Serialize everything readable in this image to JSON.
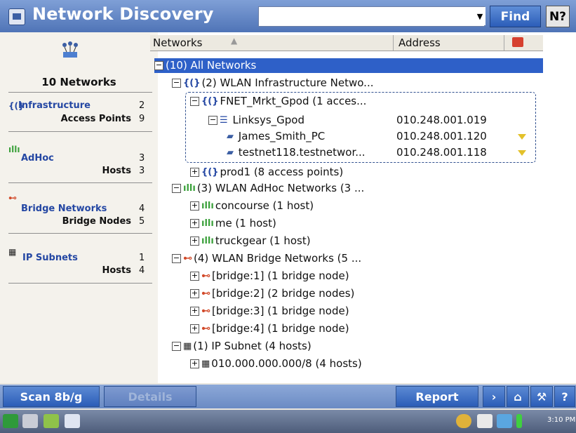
{
  "window": {
    "title": "Network Discovery"
  },
  "toolbar": {
    "search_value": "",
    "find_label": "Find",
    "help_label": "N?"
  },
  "sidebar": {
    "summary_title": "10 Networks",
    "groups": [
      {
        "category": "Infrastructure",
        "category_count": "2",
        "sub": "Access Points",
        "sub_count": "9",
        "icon": "{(}"
      },
      {
        "category": "AdHoc",
        "category_count": "3",
        "sub": "Hosts",
        "sub_count": "3",
        "icon": "dlh"
      },
      {
        "category": "Bridge Networks",
        "category_count": "4",
        "sub": "Bridge Nodes",
        "sub_count": "5",
        "icon": "bridge"
      },
      {
        "category": "IP Subnets",
        "category_count": "1",
        "sub": "Hosts",
        "sub_count": "4",
        "icon": "subnet"
      }
    ]
  },
  "tree": {
    "header_networks": "Networks",
    "header_address": "Address",
    "nodes": [
      {
        "label": "(10) All Networks",
        "selected": true
      },
      {
        "label": "(2) WLAN Infrastructure Netwo..."
      },
      {
        "label": "FNET_Mrkt_Gpod (1 acces..."
      },
      {
        "label": "Linksys_Gpod",
        "address": "010.248.001.019"
      },
      {
        "label": "James_Smith_PC",
        "address": "010.248.001.120"
      },
      {
        "label": "testnet118.testnetwor...",
        "address": "010.248.001.118"
      },
      {
        "label": "prod1  (8 access points)"
      },
      {
        "label": "(3) WLAN AdHoc Networks (3 ..."
      },
      {
        "label": "concourse (1 host)"
      },
      {
        "label": "me (1 host)"
      },
      {
        "label": "truckgear (1 host)"
      },
      {
        "label": "(4) WLAN Bridge Networks (5 ..."
      },
      {
        "label": "[bridge:1] (1 bridge node)"
      },
      {
        "label": "[bridge:2] (2 bridge nodes)"
      },
      {
        "label": "[bridge:3] (1 bridge node)"
      },
      {
        "label": "[bridge:4] (1 bridge node)"
      },
      {
        "label": "(1) IP Subnet (4 hosts)"
      },
      {
        "label": "010.000.000.000/8 (4 hosts)"
      }
    ]
  },
  "bottom": {
    "scan_label": "Scan 8b/g",
    "details_label": "Details",
    "report_label": "Report"
  },
  "taskbar": {
    "clock": "3:10 PM"
  },
  "colors": {
    "title_bar": "#4f74b7",
    "accent": "#2e60c8",
    "category_text": "#2447a3",
    "flag": "#e3c12a"
  }
}
